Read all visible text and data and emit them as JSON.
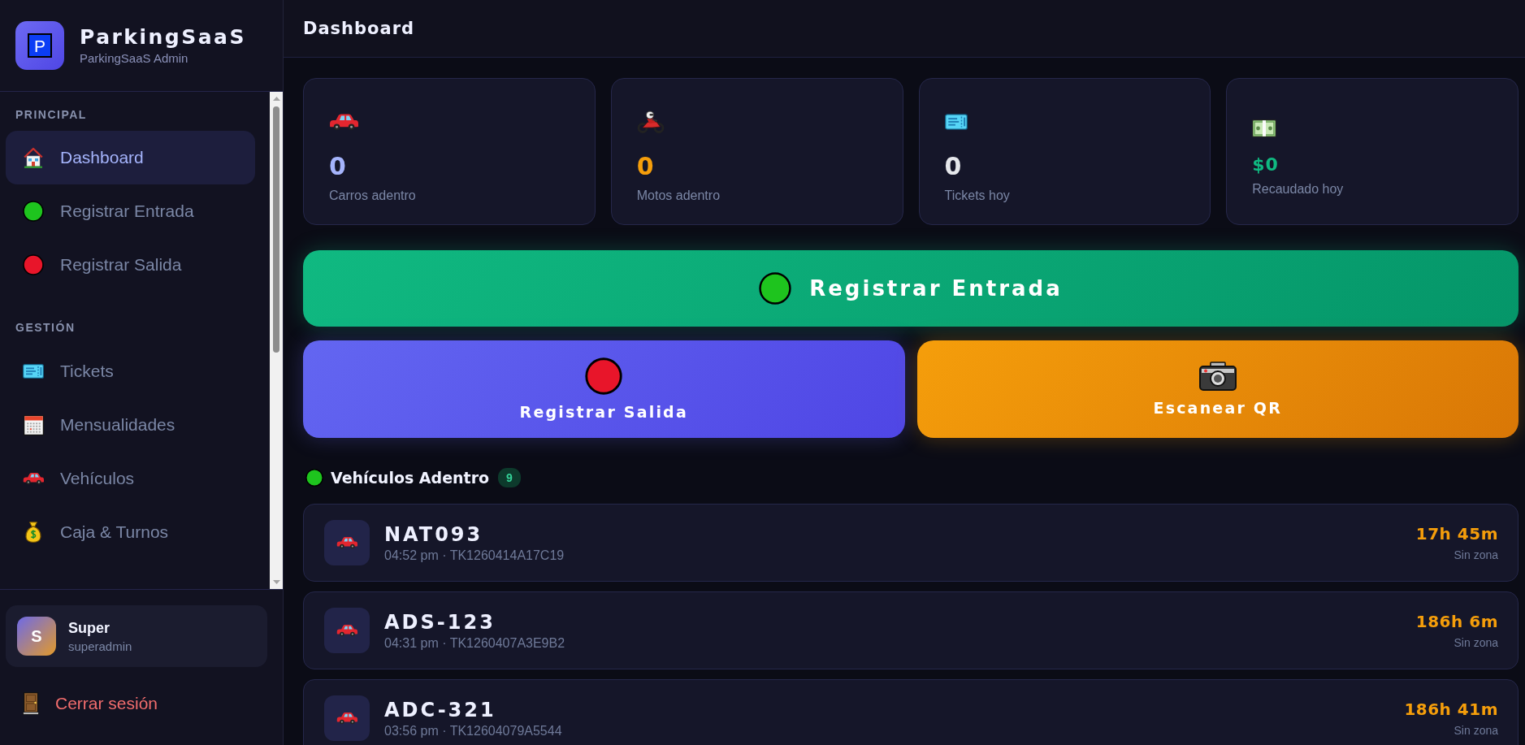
{
  "brand": {
    "logo_text": "P",
    "name": "ParkingSaaS",
    "subtitle": "ParkingSaaS Admin"
  },
  "nav": [
    {
      "title": "PRINCIPAL",
      "items": [
        {
          "label": "Dashboard",
          "selected": true
        },
        {
          "label": "Registrar Entrada",
          "selected": false
        },
        {
          "label": "Registrar Salida",
          "selected": false
        }
      ]
    },
    {
      "title": "GESTIÓN",
      "items": [
        {
          "label": "Tickets",
          "selected": false
        },
        {
          "label": "Mensualidades",
          "selected": false
        },
        {
          "label": "Vehículos",
          "selected": false
        },
        {
          "label": "Caja & Turnos",
          "selected": false
        }
      ]
    }
  ],
  "user": {
    "initial": "S",
    "name": "Super",
    "username": "superadmin"
  },
  "logout": {
    "label": "Cerrar sesión"
  },
  "header": {
    "title": "Dashboard"
  },
  "stats": [
    {
      "kind": "count",
      "value": "0",
      "label": "Carros adentro"
    },
    {
      "kind": "count",
      "value": "0",
      "label": "Motos adentro"
    },
    {
      "kind": "count",
      "value": "0",
      "label": "Tickets hoy"
    },
    {
      "kind": "money",
      "value": "$0",
      "label": "Recaudado hoy"
    }
  ],
  "primary_action": {
    "label": "Registrar Entrada"
  },
  "secondary_actions": [
    {
      "label": "Registrar Salida"
    },
    {
      "label": "Escanear QR"
    }
  ],
  "vehicles": {
    "title": "Vehículos Adentro",
    "count": "9",
    "items": [
      {
        "plate": "NAT093",
        "details": "04:52 pm · TK1260414A17C19",
        "duration": "17h 45m",
        "zone": "Sin zona"
      },
      {
        "plate": "ADS-123",
        "details": "04:31 pm · TK1260407A3E9B2",
        "duration": "186h 6m",
        "zone": "Sin zona"
      },
      {
        "plate": "ADC-321",
        "details": "03:56 pm · TK12604079A5544",
        "duration": "186h 41m",
        "zone": "Sin zona"
      }
    ]
  }
}
